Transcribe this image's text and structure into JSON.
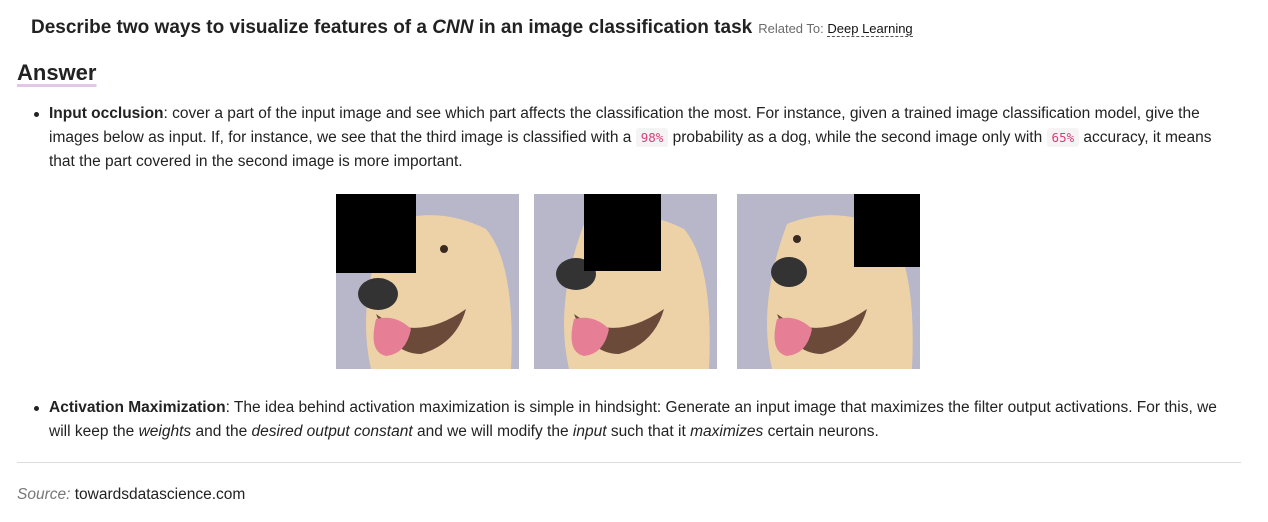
{
  "question": {
    "prefix": "Describe two ways to visualize features of a ",
    "em": "CNN",
    "suffix": " in an image classification task",
    "related_label": "Related To:",
    "related_link": "Deep Learning"
  },
  "answer_heading": "Answer",
  "bullet1": {
    "term": "Input occlusion",
    "t1": ": cover a part of the input image and see which part affects the classification the most. For instance, given a trained image classification model, give the images below as input. If, for instance, we see that the third image is classified with a ",
    "code1": "98%",
    "t2": " probability as a dog, while the second image only with ",
    "code2": "65%",
    "t3": " accuracy, it means that the part covered in the second image is more important."
  },
  "bullet2": {
    "term": "Activation Maximization",
    "t1": ": The idea behind activation maximization is simple in hindsight: Generate an input image that maximizes the filter output activations. For this, we will keep the ",
    "em1": "weights",
    "t2": " and the ",
    "em2": "desired output constant",
    "t3": " and we will modify the ",
    "em3": "input",
    "t4": " such that it ",
    "em4": "maximizes",
    "t5": " certain neurons."
  },
  "source": {
    "label": "Source:",
    "value": "towardsdatascience.com"
  },
  "figure": {
    "background": "#b7b7c9",
    "fur": "#ecd2a6",
    "tongue": "#e67f96",
    "mask": "#000000"
  }
}
